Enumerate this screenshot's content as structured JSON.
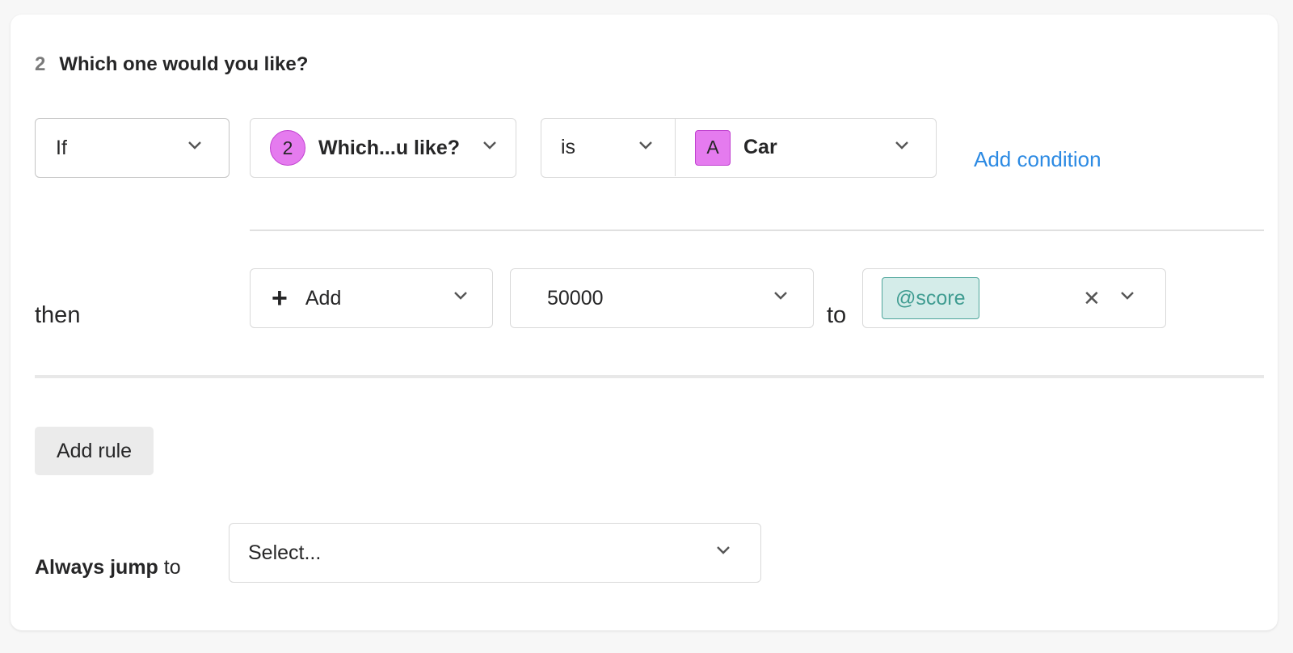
{
  "question": {
    "number": "2",
    "title": "Which one would you like?"
  },
  "condition": {
    "if_label": "If",
    "field_badge": "2",
    "field_label": "Which...u like?",
    "operator": "is",
    "value_badge": "A",
    "value_label": "Car",
    "add_condition": "Add condition"
  },
  "action": {
    "then_label": "then",
    "action_icon": "plus-icon",
    "action_label": "Add",
    "amount": "50000",
    "to_label": "to",
    "variable": "@score"
  },
  "add_rule": "Add rule",
  "jump": {
    "label_bold": "Always jump",
    "label_rest": "to",
    "placeholder": "Select..."
  },
  "colors": {
    "accent_link": "#2c8ae3",
    "badge_fill": "#e57bef",
    "variable_tag_fill": "#d4ece9",
    "variable_tag_text": "#3f9c91"
  }
}
